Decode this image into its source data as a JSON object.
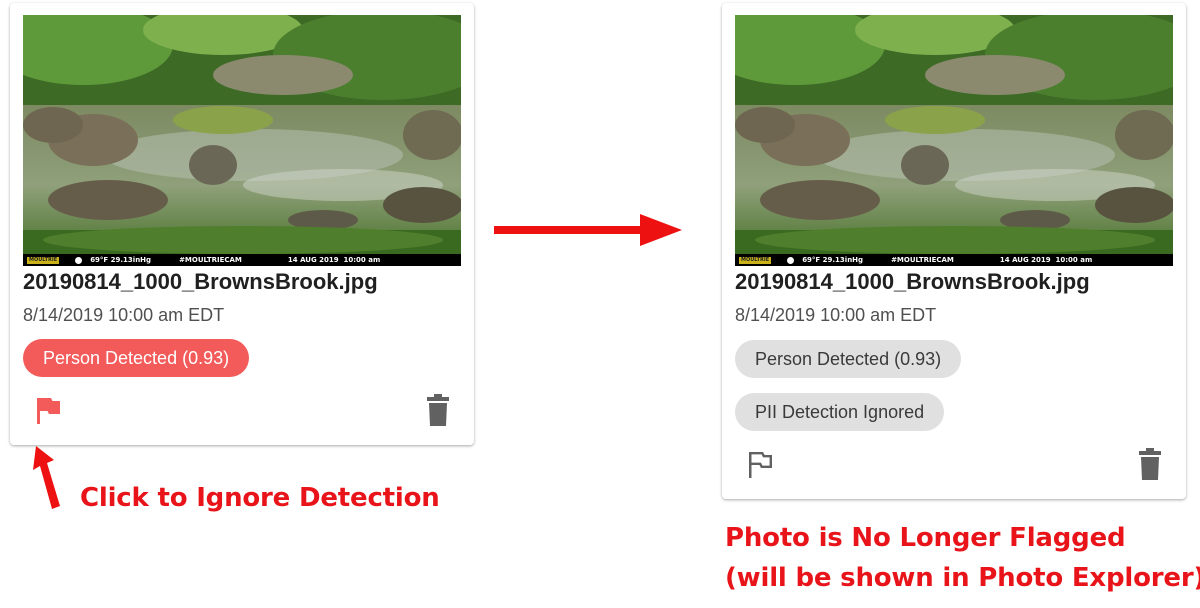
{
  "left_card": {
    "photo_stamp": {
      "brand": "MOULTRIE",
      "temperature": "69°F",
      "pressure": "29.13inHg",
      "tag": "#MOULTRIECAM",
      "date": "14 AUG 2019",
      "time": "10:00 am"
    },
    "filename": "20190814_1000_BrownsBrook.jpg",
    "timestamp": "8/14/2019 10:00 am EDT",
    "detection_chip": "Person Detected (0.93)",
    "flag_icon": "flag-filled-icon",
    "delete_icon": "trash-icon"
  },
  "right_card": {
    "photo_stamp": {
      "brand": "MOULTRIE",
      "temperature": "69°F",
      "pressure": "29.13inHg",
      "tag": "#MOULTRIECAM",
      "date": "14 AUG 2019",
      "time": "10:00 am"
    },
    "filename": "20190814_1000_BrownsBrook.jpg",
    "timestamp": "8/14/2019 10:00 am EDT",
    "detection_chip": "Person Detected (0.93)",
    "ignored_chip": "PII Detection Ignored",
    "flag_icon": "flag-outline-icon",
    "delete_icon": "trash-icon"
  },
  "annotations": {
    "left_caption": "Click to Ignore Detection",
    "right_caption_line1": "Photo is No Longer Flagged",
    "right_caption_line2": "(will be shown in Photo Explorer)"
  },
  "colors": {
    "annotation_red": "#ee1111",
    "flag_active": "#f35a5a",
    "chip_active_bg": "#f35a5a",
    "chip_neutral_bg": "#e0e0e0",
    "icon_grey": "#616161"
  }
}
